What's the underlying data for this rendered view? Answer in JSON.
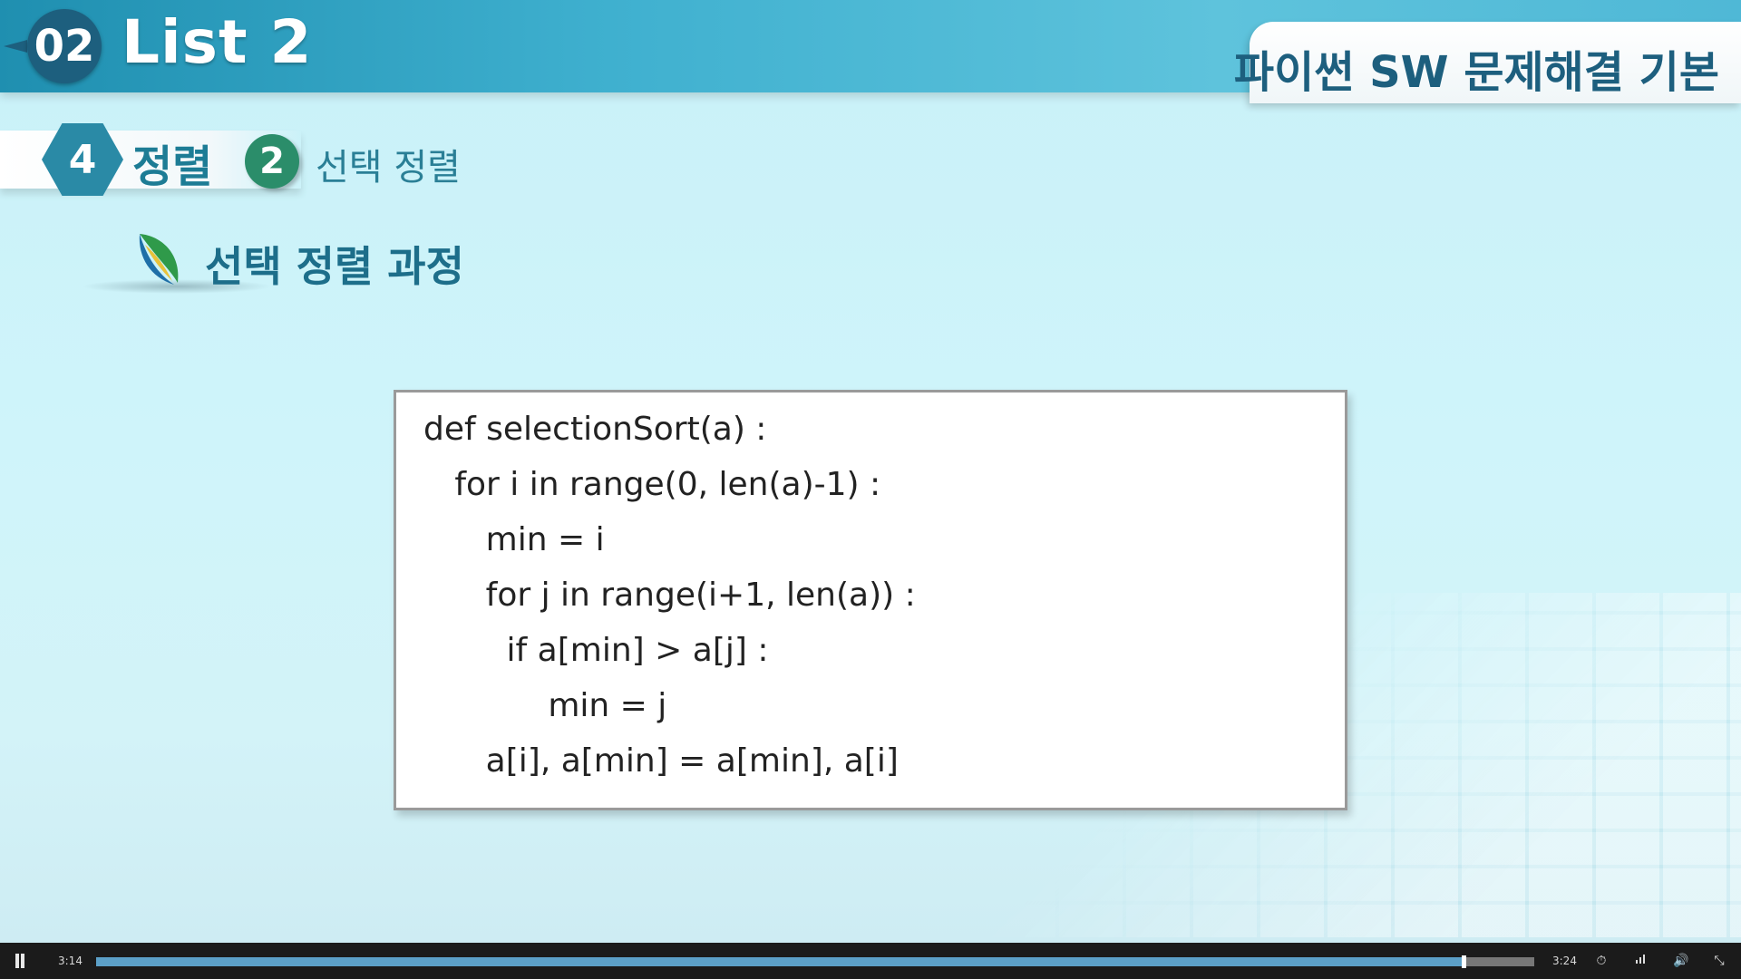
{
  "header": {
    "chapter_number": "02",
    "chapter_title": "List 2",
    "course_title": "파이썬 SW 문제해결 기본"
  },
  "section": {
    "number": "4",
    "label": "정렬",
    "sub_number": "2",
    "sub_label": "선택 정렬"
  },
  "heading": "선택 정렬 과정",
  "code": {
    "lines": [
      "def selectionSort(a) :",
      "   for i in range(0, len(a)-1) :",
      "      min = i",
      "      for j in range(i+1, len(a)) :",
      "        if a[min] > a[j] :",
      "            min = j",
      "      a[i], a[min] = a[min], a[i]"
    ]
  },
  "player": {
    "current_time": "3:14",
    "total_time": "3:24",
    "progress_fraction": 0.951,
    "icons": [
      "pause-icon",
      "speed-icon",
      "quality-icon",
      "volume-icon",
      "fullscreen-exit-icon"
    ]
  },
  "colors": {
    "banner": "#3fb0cf",
    "chapter_circle": "#1d5f7e",
    "hex_badge": "#2a8aa6",
    "sub_circle": "#2b8d6a",
    "progress": "#5ca0c8"
  }
}
